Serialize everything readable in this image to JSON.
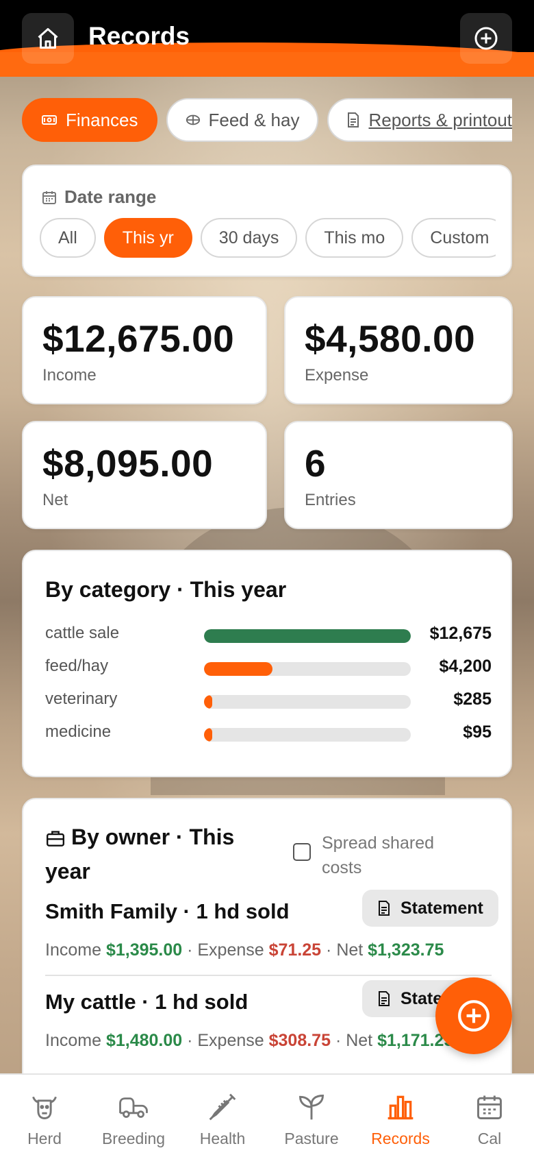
{
  "header": {
    "title": "Records",
    "home_icon": "home-icon",
    "add_icon": "plus-circle-icon"
  },
  "tabs": [
    {
      "label": "Finances",
      "icon": "money-icon",
      "active": true
    },
    {
      "label": "Feed & hay",
      "icon": "hay-bale-icon",
      "active": false
    },
    {
      "label": "Reports & printout",
      "icon": "document-icon",
      "active": false
    }
  ],
  "date_range": {
    "title": "Date range",
    "chips": [
      "All",
      "This yr",
      "30 days",
      "This mo",
      "Custom"
    ],
    "selected": "This yr"
  },
  "stats": {
    "income": {
      "value": "$12,675.00",
      "label": "Income"
    },
    "expense": {
      "value": "$4,580.00",
      "label": "Expense"
    },
    "net": {
      "value": "$8,095.00",
      "label": "Net"
    },
    "entries": {
      "value": "6",
      "label": "Entries"
    }
  },
  "by_category": {
    "title": "By category · This year",
    "rows": [
      {
        "name": "cattle sale",
        "amount": "$12,675",
        "fraction": 1.0,
        "color": "#2e7d4f"
      },
      {
        "name": "feed/hay",
        "amount": "$4,200",
        "fraction": 0.331,
        "color": "#ff5f08"
      },
      {
        "name": "veterinary",
        "amount": "$285",
        "fraction": 0.04,
        "color": "#ff5f08"
      },
      {
        "name": "medicine",
        "amount": "$95",
        "fraction": 0.04,
        "color": "#ff5f08"
      }
    ]
  },
  "by_owner": {
    "title": "By owner · This year",
    "spread_label": "Spread shared costs",
    "spread_checked": false,
    "owners": [
      {
        "name": "Smith Family · 1 hd sold",
        "button": "Statement",
        "income_label": "Income",
        "income": "$1,395.00",
        "expense_label": "Expense",
        "expense": "$71.25",
        "net_label": "Net",
        "net": "$1,323.75"
      },
      {
        "name": "My cattle · 1 hd sold",
        "button": "Statement",
        "income_label": "Income",
        "income": "$1,480.00",
        "expense_label": "Expense",
        "expense": "$308.75",
        "net_label": "Net",
        "net": "$1,171.25"
      }
    ]
  },
  "fab_icon": "plus-circle-icon",
  "bottom_nav": [
    {
      "label": "Herd",
      "icon": "cow-icon",
      "active": false
    },
    {
      "label": "Breeding",
      "icon": "trailer-icon",
      "active": false
    },
    {
      "label": "Health",
      "icon": "syringe-icon",
      "active": false
    },
    {
      "label": "Pasture",
      "icon": "sprout-icon",
      "active": false
    },
    {
      "label": "Records",
      "icon": "bar-chart-icon",
      "active": true
    },
    {
      "label": "Cal",
      "icon": "calendar-icon",
      "active": false
    }
  ],
  "colors": {
    "accent": "#ff5f08",
    "positive": "#2b8a49",
    "negative": "#c94436"
  }
}
